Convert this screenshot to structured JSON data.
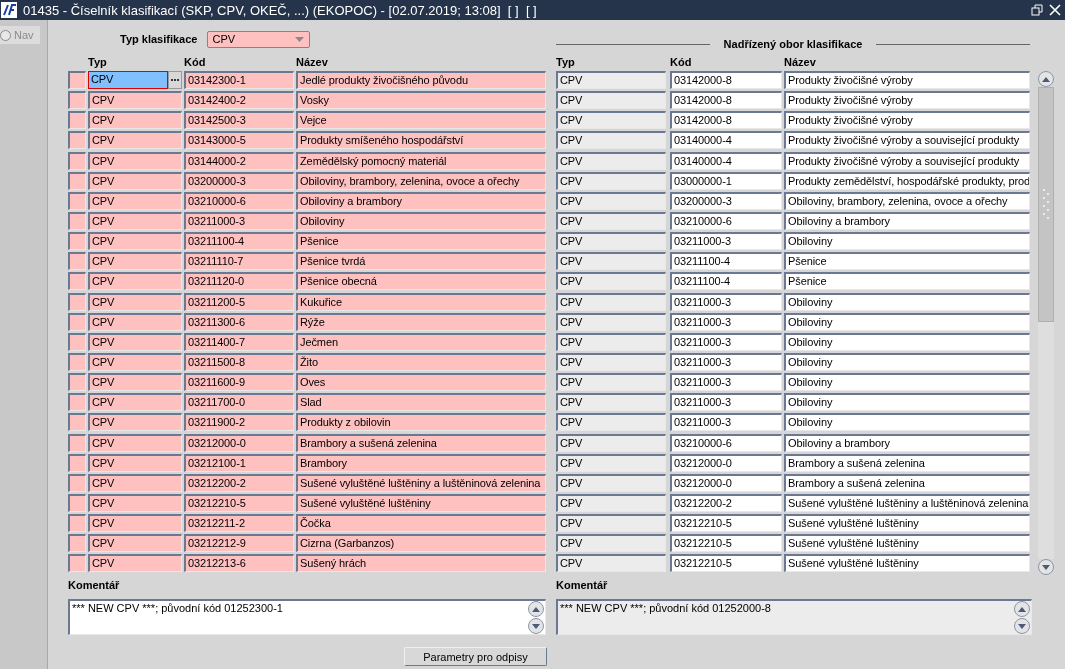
{
  "window": {
    "title": "01435 - Číselník klasifikací (SKP, CPV, OKEČ, ...) (EKOPOC) - [02.07.2019; 13:08]  [ ]  [ ]"
  },
  "nav": {
    "label": "Nav",
    "disabled": true
  },
  "filter": {
    "label": "Typ klasifikace",
    "value": "CPV"
  },
  "parent_section": {
    "title": "Nadřízený obor klasifikace"
  },
  "columns": {
    "left": [
      "Typ",
      "Kód",
      "Název"
    ],
    "right": [
      "Typ",
      "Kód",
      "Název"
    ]
  },
  "rows": [
    {
      "selected": true,
      "typ": "CPV",
      "kod": "03142300-1",
      "nazev": "Jedlé produkty živočišného původu",
      "parent_typ": "CPV",
      "parent_kod": "03142000-8",
      "parent_nazev": "Produkty živočišné výroby"
    },
    {
      "selected": false,
      "typ": "CPV",
      "kod": "03142400-2",
      "nazev": "Vosky",
      "parent_typ": "CPV",
      "parent_kod": "03142000-8",
      "parent_nazev": "Produkty živočišné výroby"
    },
    {
      "selected": false,
      "typ": "CPV",
      "kod": "03142500-3",
      "nazev": "Vejce",
      "parent_typ": "CPV",
      "parent_kod": "03142000-8",
      "parent_nazev": "Produkty živočišné výroby"
    },
    {
      "selected": false,
      "typ": "CPV",
      "kod": "03143000-5",
      "nazev": "Produkty smíšeného hospodářství",
      "parent_typ": "CPV",
      "parent_kod": "03140000-4",
      "parent_nazev": "Produkty živočišné výroby a související produkty"
    },
    {
      "selected": false,
      "typ": "CPV",
      "kod": "03144000-2",
      "nazev": "Zemědělský pomocný materiál",
      "parent_typ": "CPV",
      "parent_kod": "03140000-4",
      "parent_nazev": "Produkty živočišné výroby a související produkty"
    },
    {
      "selected": false,
      "typ": "CPV",
      "kod": "03200000-3",
      "nazev": "Obiloviny, brambory, zelenina, ovoce a ořechy",
      "parent_typ": "CPV",
      "parent_kod": "03000000-1",
      "parent_nazev": "Produkty zemědělství, hospodářské produkty, prod"
    },
    {
      "selected": false,
      "typ": "CPV",
      "kod": "03210000-6",
      "nazev": "Obiloviny a brambory",
      "parent_typ": "CPV",
      "parent_kod": "03200000-3",
      "parent_nazev": "Obiloviny, brambory, zelenina, ovoce a ořechy"
    },
    {
      "selected": false,
      "typ": "CPV",
      "kod": "03211000-3",
      "nazev": "Obiloviny",
      "parent_typ": "CPV",
      "parent_kod": "03210000-6",
      "parent_nazev": "Obiloviny a brambory"
    },
    {
      "selected": false,
      "typ": "CPV",
      "kod": "03211100-4",
      "nazev": "Pšenice",
      "parent_typ": "CPV",
      "parent_kod": "03211000-3",
      "parent_nazev": "Obiloviny"
    },
    {
      "selected": false,
      "typ": "CPV",
      "kod": "03211110-7",
      "nazev": "Pšenice tvrdá",
      "parent_typ": "CPV",
      "parent_kod": "03211100-4",
      "parent_nazev": "Pšenice"
    },
    {
      "selected": false,
      "typ": "CPV",
      "kod": "03211120-0",
      "nazev": "Pšenice obecná",
      "parent_typ": "CPV",
      "parent_kod": "03211100-4",
      "parent_nazev": "Pšenice"
    },
    {
      "selected": false,
      "typ": "CPV",
      "kod": "03211200-5",
      "nazev": "Kukuřice",
      "parent_typ": "CPV",
      "parent_kod": "03211000-3",
      "parent_nazev": "Obiloviny"
    },
    {
      "selected": false,
      "typ": "CPV",
      "kod": "03211300-6",
      "nazev": "Rýže",
      "parent_typ": "CPV",
      "parent_kod": "03211000-3",
      "parent_nazev": "Obiloviny"
    },
    {
      "selected": false,
      "typ": "CPV",
      "kod": "03211400-7",
      "nazev": "Ječmen",
      "parent_typ": "CPV",
      "parent_kod": "03211000-3",
      "parent_nazev": "Obiloviny"
    },
    {
      "selected": false,
      "typ": "CPV",
      "kod": "03211500-8",
      "nazev": "Žito",
      "parent_typ": "CPV",
      "parent_kod": "03211000-3",
      "parent_nazev": "Obiloviny"
    },
    {
      "selected": false,
      "typ": "CPV",
      "kod": "03211600-9",
      "nazev": "Oves",
      "parent_typ": "CPV",
      "parent_kod": "03211000-3",
      "parent_nazev": "Obiloviny"
    },
    {
      "selected": false,
      "typ": "CPV",
      "kod": "03211700-0",
      "nazev": "Slad",
      "parent_typ": "CPV",
      "parent_kod": "03211000-3",
      "parent_nazev": "Obiloviny"
    },
    {
      "selected": false,
      "typ": "CPV",
      "kod": "03211900-2",
      "nazev": "Produkty z obilovin",
      "parent_typ": "CPV",
      "parent_kod": "03211000-3",
      "parent_nazev": "Obiloviny"
    },
    {
      "selected": false,
      "typ": "CPV",
      "kod": "03212000-0",
      "nazev": "Brambory a sušená zelenina",
      "parent_typ": "CPV",
      "parent_kod": "03210000-6",
      "parent_nazev": "Obiloviny a brambory"
    },
    {
      "selected": false,
      "typ": "CPV",
      "kod": "03212100-1",
      "nazev": "Brambory",
      "parent_typ": "CPV",
      "parent_kod": "03212000-0",
      "parent_nazev": "Brambory a sušená zelenina"
    },
    {
      "selected": false,
      "typ": "CPV",
      "kod": "03212200-2",
      "nazev": "Sušené vyluštěné luštěniny a luštěninová zelenina",
      "parent_typ": "CPV",
      "parent_kod": "03212000-0",
      "parent_nazev": "Brambory a sušená zelenina"
    },
    {
      "selected": false,
      "typ": "CPV",
      "kod": "03212210-5",
      "nazev": "Sušené vyluštěné luštěniny",
      "parent_typ": "CPV",
      "parent_kod": "03212200-2",
      "parent_nazev": "Sušené vyluštěné luštěniny a luštěninová zelenina"
    },
    {
      "selected": false,
      "typ": "CPV",
      "kod": "03212211-2",
      "nazev": "Čočka",
      "parent_typ": "CPV",
      "parent_kod": "03212210-5",
      "parent_nazev": "Sušené vyluštěné luštěniny"
    },
    {
      "selected": false,
      "typ": "CPV",
      "kod": "03212212-9",
      "nazev": "Cizrna (Garbanzos)",
      "parent_typ": "CPV",
      "parent_kod": "03212210-5",
      "parent_nazev": "Sušené vyluštěné luštěniny"
    },
    {
      "selected": false,
      "typ": "CPV",
      "kod": "03212213-6",
      "nazev": "Sušený hrách",
      "parent_typ": "CPV",
      "parent_kod": "03212210-5",
      "parent_nazev": "Sušené vyluštěné luštěniny"
    }
  ],
  "comments": [
    {
      "label": "Komentář",
      "value": "*** NEW CPV ***; původní kód 01252300-1",
      "disabled": false
    },
    {
      "label": "Komentář",
      "value": "*** NEW CPV ***; původní kód 01252000-8",
      "disabled": true
    }
  ],
  "buttons": [
    "Parametry pro odpisy"
  ]
}
